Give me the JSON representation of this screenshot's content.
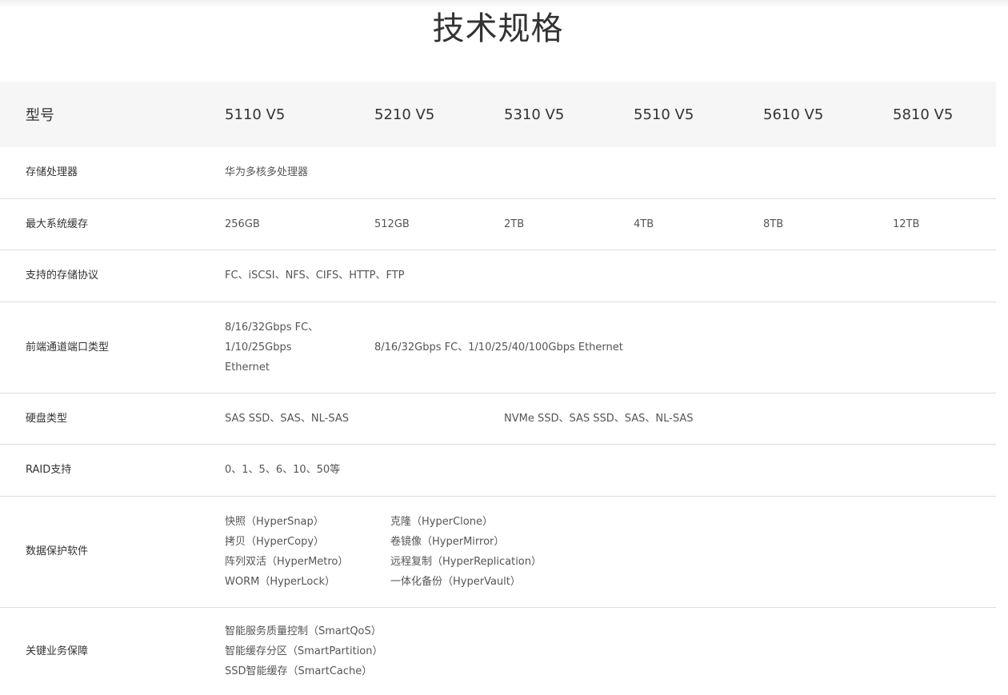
{
  "page_title": "技术规格",
  "header": {
    "label": "型号",
    "models": [
      "5110 V5",
      "5210 V5",
      "5310 V5",
      "5510 V5",
      "5610 V5",
      "5810 V5"
    ]
  },
  "rows": {
    "processor": {
      "label": "存储处理器",
      "value": "华为多核多处理器"
    },
    "cache": {
      "label": "最大系统缓存",
      "values": [
        "256GB",
        "512GB",
        "2TB",
        "4TB",
        "8TB",
        "12TB"
      ]
    },
    "protocols": {
      "label": "支持的存储协议",
      "value": "FC、iSCSI、NFS、CIFS、HTTP、FTP"
    },
    "frontend": {
      "label": "前端通道端口类型",
      "model_5110_lines": [
        "8/16/32Gbps FC、",
        "1/10/25Gbps",
        "Ethernet"
      ],
      "others": "8/16/32Gbps FC、1/10/25/40/100Gbps Ethernet"
    },
    "disk": {
      "label": "硬盘类型",
      "low": "SAS SSD、SAS、NL-SAS",
      "high": "NVMe SSD、SAS SSD、SAS、NL-SAS"
    },
    "raid": {
      "label": "RAID支持",
      "value": "0、1、5、6、10、50等"
    },
    "protection": {
      "label": "数据保护软件",
      "left": [
        "快照（HyperSnap）",
        "拷贝（HyperCopy）",
        "阵列双活（HyperMetro）",
        "WORM（HyperLock）"
      ],
      "right": [
        "克隆（HyperClone）",
        "卷镜像（HyperMirror）",
        "远程复制（HyperReplication）",
        "一体化备份（HyperVault）"
      ]
    },
    "business": {
      "label": "关键业务保障",
      "items": [
        "智能服务质量控制（SmartQoS）",
        "智能缓存分区（SmartPartition）",
        "SSD智能缓存（SmartCache）"
      ]
    }
  }
}
